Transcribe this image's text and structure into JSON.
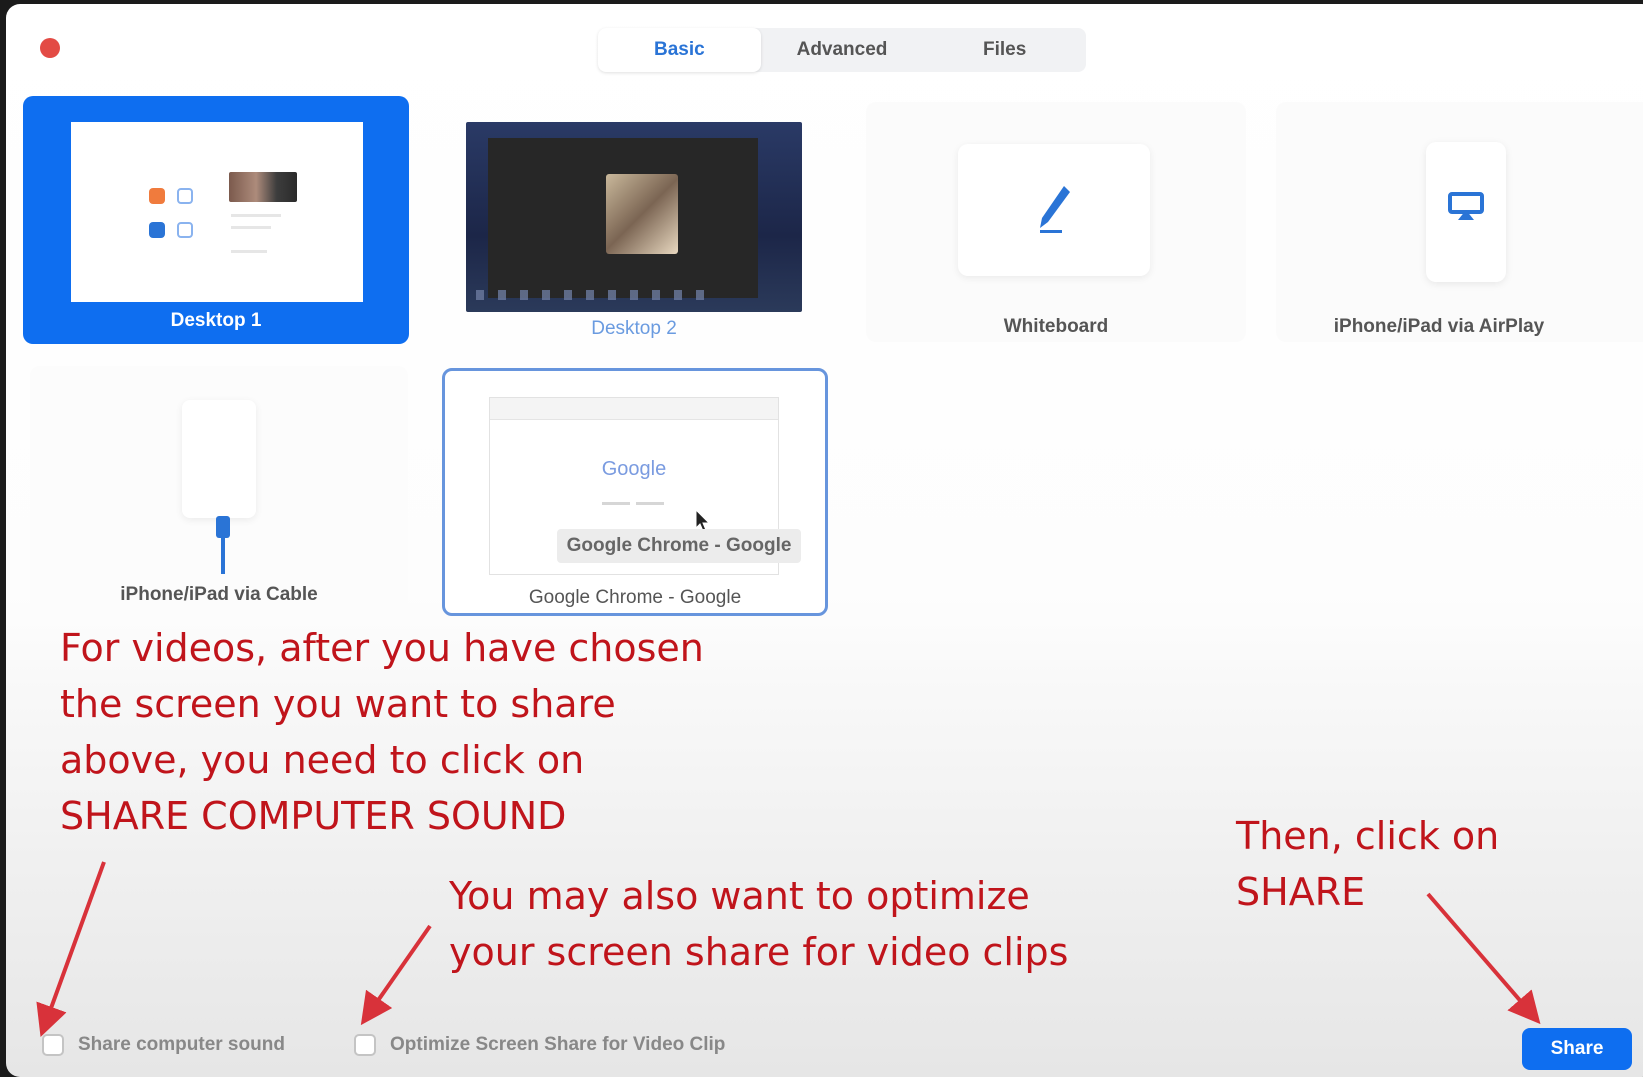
{
  "window": {
    "close_icon": "close-dot-icon",
    "close_color": "#e34b45"
  },
  "tabs": [
    {
      "label": "Basic",
      "active": true
    },
    {
      "label": "Advanced",
      "active": false
    },
    {
      "label": "Files",
      "active": false
    }
  ],
  "share_options": [
    {
      "label": "Desktop 1",
      "selected": true
    },
    {
      "label": "Desktop 2",
      "selected": false
    },
    {
      "label": "Whiteboard",
      "icon": "pencil-icon"
    },
    {
      "label": "iPhone/iPad via AirPlay",
      "icon": "airplay-icon"
    },
    {
      "label": "iPhone/iPad via Cable",
      "icon": "cable-icon"
    },
    {
      "label": "Google Chrome - Google",
      "tooltip": "Google Chrome - Google",
      "preview_logo": "Google"
    }
  ],
  "annotations": {
    "computer_sound": [
      "For videos, after you have chosen",
      "the screen you want to share",
      "above, you need to click on",
      "SHARE COMPUTER SOUND"
    ],
    "optimize": [
      "You may also want to optimize",
      "your screen share for video clips"
    ],
    "share": [
      "Then, click on",
      "SHARE"
    ],
    "color": "#c0141b"
  },
  "options": {
    "share_computer_sound": {
      "label": "Share computer sound",
      "checked": false
    },
    "optimize_video": {
      "label": "Optimize Screen Share for Video Clip",
      "checked": false
    }
  },
  "share_button": {
    "label": "Share",
    "color": "#0e6ef0"
  }
}
